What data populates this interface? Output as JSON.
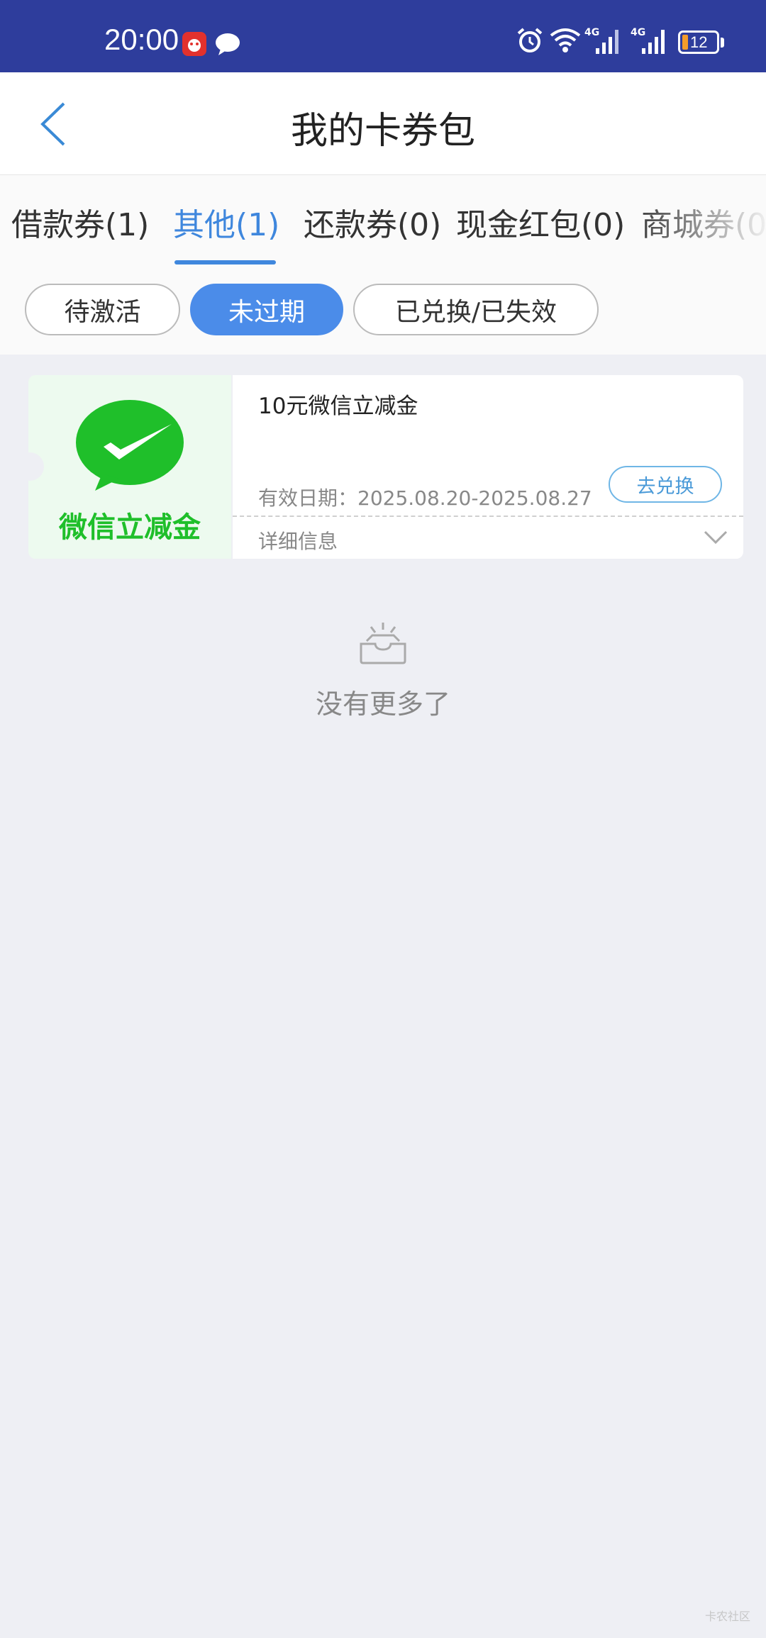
{
  "status_bar": {
    "time": "20:00",
    "battery": "12",
    "network_1": "4G",
    "network_2": "4G",
    "icons": [
      "app-notification-icon",
      "message-icon",
      "alarm-icon",
      "wifi-icon",
      "signal-icon",
      "signal-icon",
      "battery-icon"
    ]
  },
  "header": {
    "title": "我的卡券包"
  },
  "tabs": [
    {
      "label": "借款券(1)"
    },
    {
      "label": "其他(1)",
      "active": true
    },
    {
      "label": "还款券(0)"
    },
    {
      "label": "现金红包(0)"
    },
    {
      "label": "商城券(0"
    }
  ],
  "filters": [
    {
      "label": "待激活"
    },
    {
      "label": "未过期",
      "active": true
    },
    {
      "label": "已兑换/已失效"
    }
  ],
  "coupon": {
    "logo_text": "微信立减金",
    "name": "10元微信立减金",
    "validity": "有效日期：2025.08.20-2025.08.27",
    "redeem_label": "去兑换",
    "details_label": "详细信息",
    "brand_color": "#1fbf2a"
  },
  "empty": {
    "text": "没有更多了"
  },
  "watermark": "卡农社区",
  "colors": {
    "status_bar": "#2e3d9c",
    "accent": "#3f87dd",
    "chip_active": "#4b8ce9"
  }
}
